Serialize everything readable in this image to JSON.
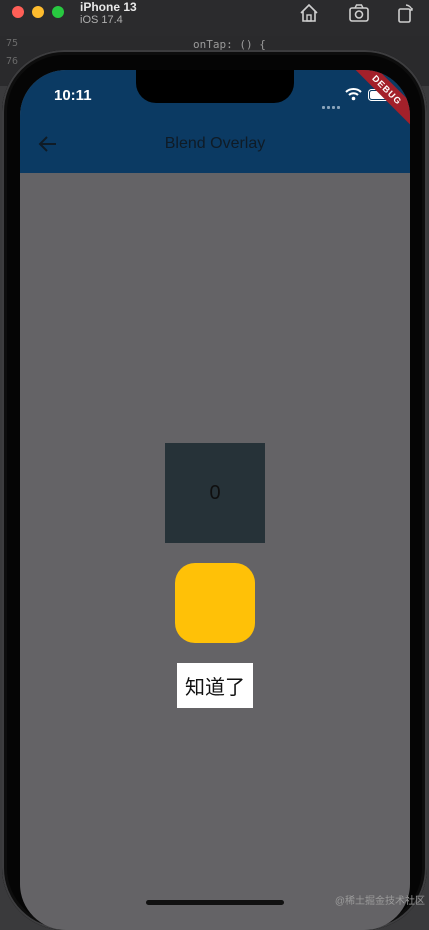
{
  "simulator": {
    "device_name": "iPhone 13",
    "os_version": "iOS 17.4",
    "toolbar_icons": [
      "home-icon",
      "screenshot-icon",
      "rotate-icon"
    ]
  },
  "code_behind": {
    "line_numbers": [
      "75",
      "76"
    ],
    "snippet": "onTap: () {"
  },
  "status_bar": {
    "time": "10:11",
    "debug_label": "DEBUG"
  },
  "app_bar": {
    "title": "Blend Overlay",
    "back_icon": "arrow-back-icon",
    "color": "#0b3a63"
  },
  "body": {
    "background": "#646366",
    "counter_value": "0",
    "counter_box_color": "#263238",
    "yellow_button_color": "#ffc107",
    "got_it_label": "知道了"
  },
  "watermark": "@稀土掘金技术社区"
}
